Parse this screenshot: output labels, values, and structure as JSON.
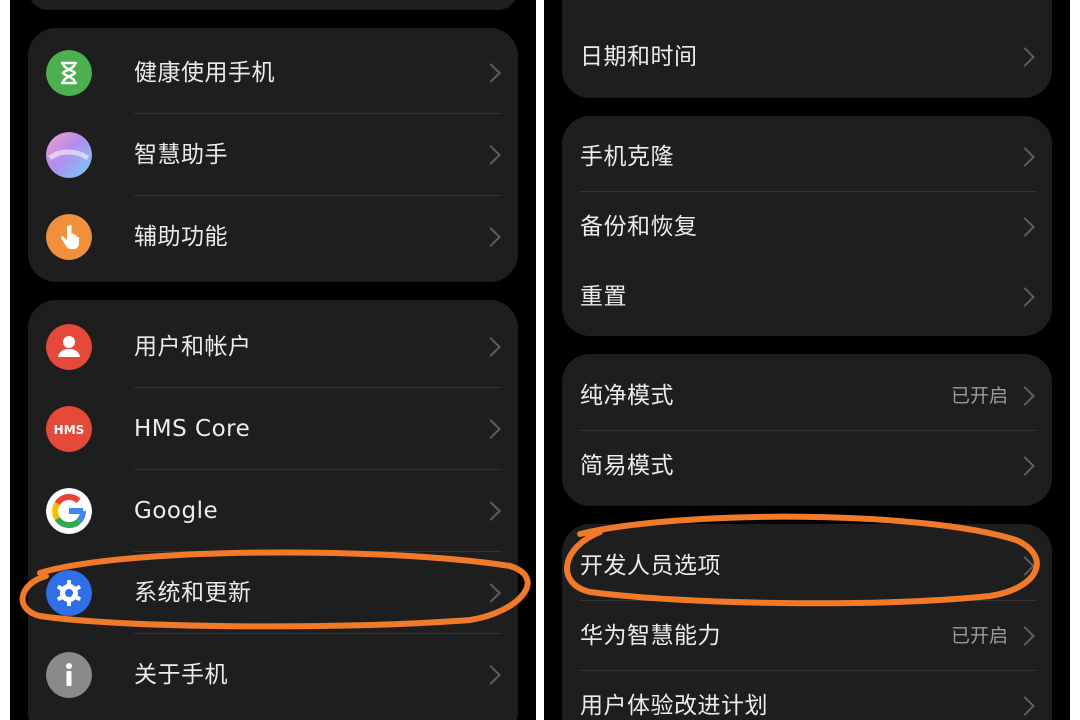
{
  "left_panel": {
    "group1": [
      {
        "label": "健康使用手机",
        "icon": "hourglass-icon",
        "color": "#4caf50"
      },
      {
        "label": "智慧助手",
        "icon": "assistant-gradient-icon",
        "color": "#b48cf0"
      },
      {
        "label": "辅助功能",
        "icon": "hand-touch-icon",
        "color": "#f0903a"
      }
    ],
    "group2": [
      {
        "label": "用户和帐户",
        "icon": "user-icon",
        "color": "#e5493a"
      },
      {
        "label": "HMS Core",
        "icon": "hms-core-icon",
        "icon_text": "HMS",
        "color": "#e5493a"
      },
      {
        "label": "Google",
        "icon": "google-g-icon"
      },
      {
        "label": "系统和更新",
        "icon": "gear-icon",
        "color": "#2f6fe8"
      },
      {
        "label": "关于手机",
        "icon": "info-icon",
        "color": "#8a8a8a"
      }
    ]
  },
  "right_panel": {
    "group1": [
      {
        "label": "日期和时间"
      }
    ],
    "group2": [
      {
        "label": "手机克隆"
      },
      {
        "label": "备份和恢复"
      },
      {
        "label": "重置"
      }
    ],
    "group3": [
      {
        "label": "纯净模式",
        "status": "已开启"
      },
      {
        "label": "简易模式"
      }
    ],
    "group4": [
      {
        "label": "开发人员选项"
      },
      {
        "label": "华为智慧能力",
        "status": "已开启"
      },
      {
        "label": "用户体验改进计划"
      }
    ]
  },
  "annotation": {
    "color": "#f07a2a",
    "highlights": [
      "系统和更新",
      "开发人员选项"
    ]
  }
}
